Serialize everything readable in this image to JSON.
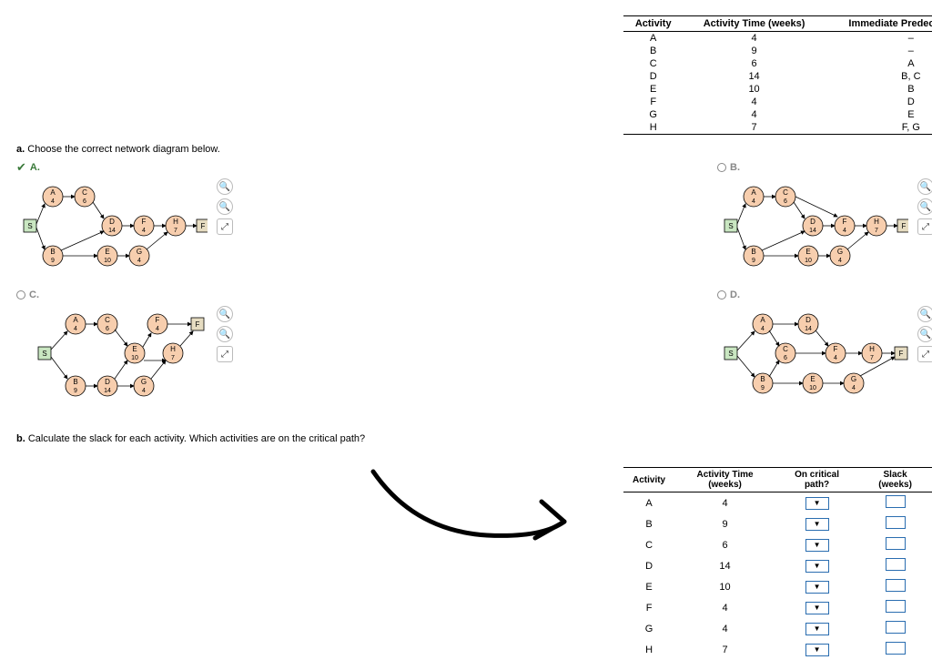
{
  "table1": {
    "headers": [
      "Activity",
      "Activity Time (weeks)",
      "Immediate Predecessor(s)"
    ],
    "rows": [
      {
        "a": "A",
        "t": "4",
        "p": "–"
      },
      {
        "a": "B",
        "t": "9",
        "p": "–"
      },
      {
        "a": "C",
        "t": "6",
        "p": "A"
      },
      {
        "a": "D",
        "t": "14",
        "p": "B, C"
      },
      {
        "a": "E",
        "t": "10",
        "p": "B"
      },
      {
        "a": "F",
        "t": "4",
        "p": "D"
      },
      {
        "a": "G",
        "t": "4",
        "p": "E"
      },
      {
        "a": "H",
        "t": "7",
        "p": "F, G"
      }
    ]
  },
  "qa": {
    "prefix": "a.",
    "text": "Choose the correct network diagram below."
  },
  "options": {
    "A": "A.",
    "B": "B.",
    "C": "C.",
    "D": "D."
  },
  "qb": {
    "prefix": "b.",
    "text": "Calculate the slack for each activity. Which activities are on the critical path?"
  },
  "table2": {
    "headers": [
      "Activity",
      "Activity Time (weeks)",
      "On critical path?",
      "Slack (weeks)"
    ],
    "rows": [
      {
        "a": "A",
        "t": "4"
      },
      {
        "a": "B",
        "t": "9"
      },
      {
        "a": "C",
        "t": "6"
      },
      {
        "a": "D",
        "t": "14"
      },
      {
        "a": "E",
        "t": "10"
      },
      {
        "a": "F",
        "t": "4"
      },
      {
        "a": "G",
        "t": "4"
      },
      {
        "a": "H",
        "t": "7"
      }
    ]
  },
  "nodes": {
    "S": "S",
    "F": "F",
    "A": {
      "l": "A",
      "v": "4"
    },
    "B": {
      "l": "B",
      "v": "9"
    },
    "C": {
      "l": "C",
      "v": "6"
    },
    "D": {
      "l": "D",
      "v": "14"
    },
    "E": {
      "l": "E",
      "v": "10"
    },
    "Fn": {
      "l": "F",
      "v": "4"
    },
    "G": {
      "l": "G",
      "v": "4"
    },
    "H": {
      "l": "H",
      "v": "7"
    }
  },
  "dropdown_glyph": "▼"
}
